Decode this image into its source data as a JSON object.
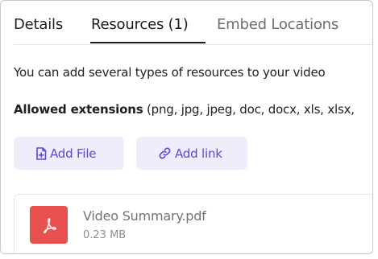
{
  "tabs": [
    {
      "label": "Details"
    },
    {
      "label": "Resources (1)"
    },
    {
      "label": "Embed Locations"
    }
  ],
  "active_tab": "Resources (1)",
  "resources": {
    "intro_text": "You can add several types of resources to your video",
    "allowed_label": "Allowed extensions",
    "allowed_values": " (png, jpg, jpeg, doc, docx, xls, xlsx,",
    "add_file_label": "Add File",
    "add_link_label": "Add link",
    "files": [
      {
        "name": "Video Summary.pdf",
        "size": "0.23 MB",
        "icon": "pdf-file-icon"
      }
    ]
  },
  "colors": {
    "accent": "#5b49d6",
    "button_bg": "#efedfc",
    "pdf_red": "#e8514d"
  },
  "icons": {
    "add_file": "file-plus-icon",
    "add_link": "link-icon",
    "file": "pdf-file-icon"
  }
}
